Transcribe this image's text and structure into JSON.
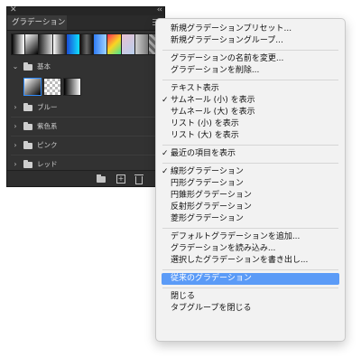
{
  "panel": {
    "close_glyph": "✕",
    "collapse_glyph": "‹‹",
    "tab_label": "グラデーション",
    "recent_swatches": [
      "linear-gradient(90deg,#000,#fff)",
      "linear-gradient(135deg,#fff,#000)",
      "linear-gradient(90deg,#222,#ddd)",
      "linear-gradient(90deg,#fff,#222)",
      "linear-gradient(90deg,#1a4bd6,#0fe0ff)",
      "linear-gradient(90deg,#111,#666,#111)",
      "linear-gradient(90deg,#2f7cf7,#9fd3ff)",
      "linear-gradient(135deg,#ff2d55,#f9d423,#42e695)",
      "linear-gradient(135deg,#e8c0d0,#b8d0ee)",
      "linear-gradient(90deg,#cfcfcf,#7a7a7a)",
      "repeating-linear-gradient(45deg,#666 0 3px,#aaa 3px 6px)"
    ],
    "groups": [
      {
        "label": "基本",
        "expanded": true
      },
      {
        "label": "ブルー",
        "expanded": false
      },
      {
        "label": "紫色系",
        "expanded": false
      },
      {
        "label": "ピンク",
        "expanded": false
      },
      {
        "label": "レッド",
        "expanded": false
      }
    ],
    "basic_thumbs": [
      "linear-gradient(135deg,#ffffff,#000000)",
      "repeating-conic-gradient(#bbb 0 25%,#fff 0 50%) 0 0/6px 6px",
      "linear-gradient(90deg,#000000,#ffffff)"
    ]
  },
  "menu": {
    "items": [
      {
        "label": "新規グラデーションプリセット...",
        "checked": false,
        "highlighted": false
      },
      {
        "label": "新規グラデーショングループ...",
        "checked": false,
        "highlighted": false
      },
      {
        "separator": true
      },
      {
        "label": "グラデーションの名前を変更...",
        "checked": false,
        "highlighted": false
      },
      {
        "label": "グラデーションを削除...",
        "checked": false,
        "highlighted": false
      },
      {
        "separator": true
      },
      {
        "label": "テキスト表示",
        "checked": false,
        "highlighted": false
      },
      {
        "label": "サムネール (小) を表示",
        "checked": true,
        "highlighted": false
      },
      {
        "label": "サムネール (大) を表示",
        "checked": false,
        "highlighted": false
      },
      {
        "label": "リスト (小) を表示",
        "checked": false,
        "highlighted": false
      },
      {
        "label": "リスト (大) を表示",
        "checked": false,
        "highlighted": false
      },
      {
        "separator": true
      },
      {
        "label": "最近の項目を表示",
        "checked": true,
        "highlighted": false
      },
      {
        "separator": true
      },
      {
        "label": "線形グラデーション",
        "checked": true,
        "highlighted": false
      },
      {
        "label": "円形グラデーション",
        "checked": false,
        "highlighted": false
      },
      {
        "label": "円錐形グラデーション",
        "checked": false,
        "highlighted": false
      },
      {
        "label": "反射形グラデーション",
        "checked": false,
        "highlighted": false
      },
      {
        "label": "菱形グラデーション",
        "checked": false,
        "highlighted": false
      },
      {
        "separator": true
      },
      {
        "label": "デフォルトグラデーションを追加...",
        "checked": false,
        "highlighted": false
      },
      {
        "label": "グラデーションを読み込み...",
        "checked": false,
        "highlighted": false
      },
      {
        "label": "選択したグラデーションを書き出し...",
        "checked": false,
        "highlighted": false
      },
      {
        "separator": true
      },
      {
        "label": "従来のグラデーション",
        "checked": false,
        "highlighted": true
      },
      {
        "separator": true
      },
      {
        "label": "閉じる",
        "checked": false,
        "highlighted": false
      },
      {
        "label": "タブグループを閉じる",
        "checked": false,
        "highlighted": false
      }
    ],
    "highlight_color": "#5b9bf7"
  }
}
